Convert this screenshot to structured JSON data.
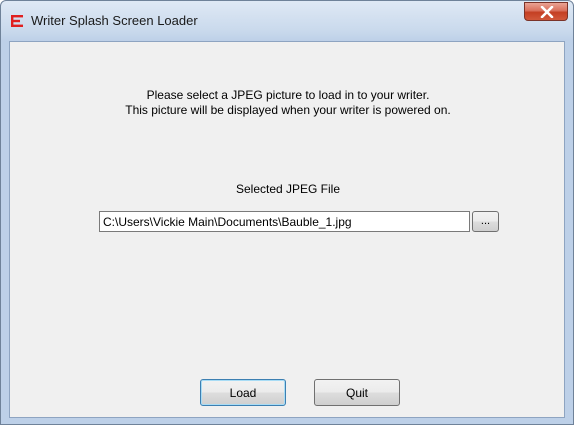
{
  "window": {
    "title": "Writer Splash Screen Loader",
    "icon": "writer-app-icon",
    "close_icon": "close-x-icon"
  },
  "instructions": {
    "line1": "Please select a JPEG picture to load in to your writer.",
    "line2": "This picture will be displayed when your writer is powered on."
  },
  "file": {
    "label": "Selected JPEG File",
    "path": "C:\\Users\\Vickie Main\\Documents\\Bauble_1.jpg",
    "browse_label": "..."
  },
  "buttons": {
    "load_label": "Load",
    "quit_label": "Quit"
  },
  "colors": {
    "close_button": "#c43f23",
    "dialog_background": "#f0f0f0",
    "titlebar": "#c9d9ec",
    "app_icon": "#e02020"
  }
}
